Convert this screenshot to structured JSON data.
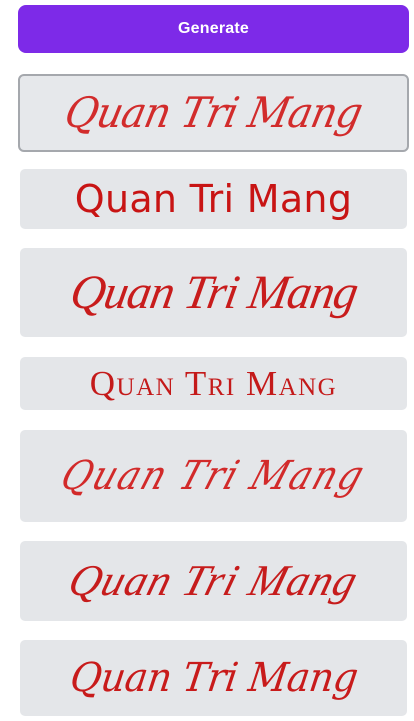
{
  "generate_button": {
    "label": "Generate"
  },
  "colors": {
    "button_bg": "#7d2ae8",
    "button_text": "#ffffff",
    "card_bg": "#e4e6e9",
    "selected_border": "#a5a8ad",
    "text_red": "#cc1d1d"
  },
  "font_options": [
    {
      "text": "Quan Tri Mang",
      "selected": true
    },
    {
      "text": "Quan Tri Mang",
      "selected": false
    },
    {
      "text": "Quan Tri Mang",
      "selected": false
    },
    {
      "text": "Quan Tri Mang",
      "selected": false
    },
    {
      "text": "Quan Tri Mang",
      "selected": false
    },
    {
      "text": "Quan Tri Mang",
      "selected": false
    },
    {
      "text": "Quan Tri Mang",
      "selected": false
    }
  ]
}
